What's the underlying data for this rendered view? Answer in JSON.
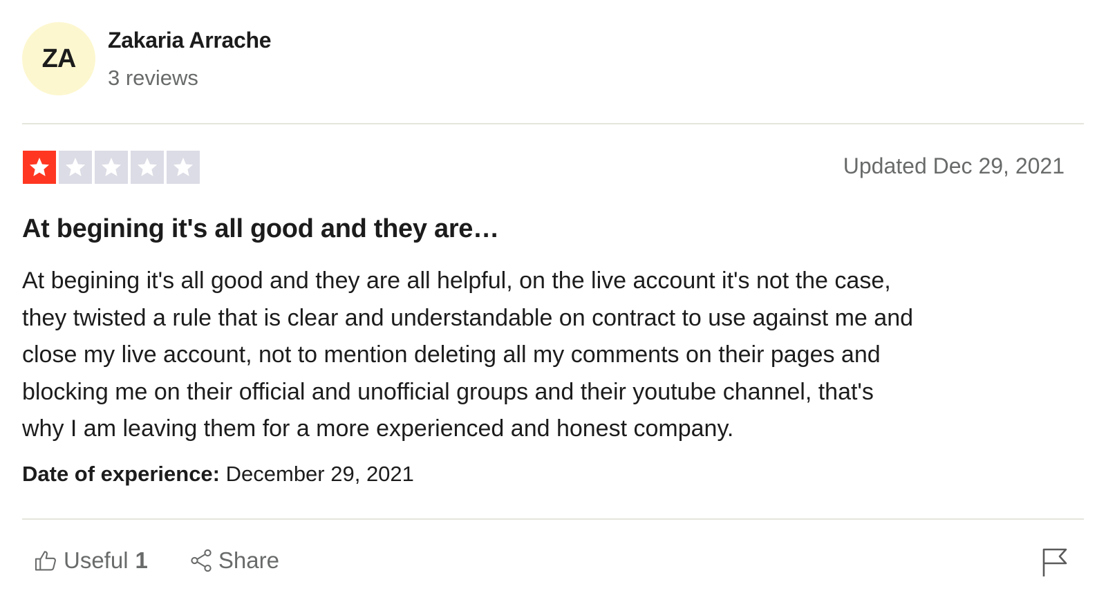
{
  "reviewer": {
    "initials": "ZA",
    "name": "Zakaria Arrache",
    "review_count": "3 reviews",
    "avatar_color": "#fdf7d0"
  },
  "review": {
    "rating": 1,
    "max_rating": 5,
    "star_filled_color": "#ff3722",
    "star_empty_color": "#dcdce6",
    "updated": "Updated Dec 29, 2021",
    "title": "At begining it's all good and they are…",
    "body_lines": [
      "At begining it's all good and they are all helpful, on the live account it's not the case,",
      "they twisted a rule that is clear and understandable on contract to use against me and",
      "close my live account, not to mention deleting all my comments on their pages and",
      "blocking me on their official and unofficial groups and their youtube channel, that's",
      "why I am leaving them for a more experienced and honest company."
    ],
    "experience_label": "Date of experience:",
    "experience_date": "December 29, 2021"
  },
  "actions": {
    "useful_label": "Useful",
    "useful_count": "1",
    "useful_icon": "thumbs-up-icon",
    "share_label": "Share",
    "share_icon": "share-icon",
    "report_icon": "flag-icon"
  }
}
